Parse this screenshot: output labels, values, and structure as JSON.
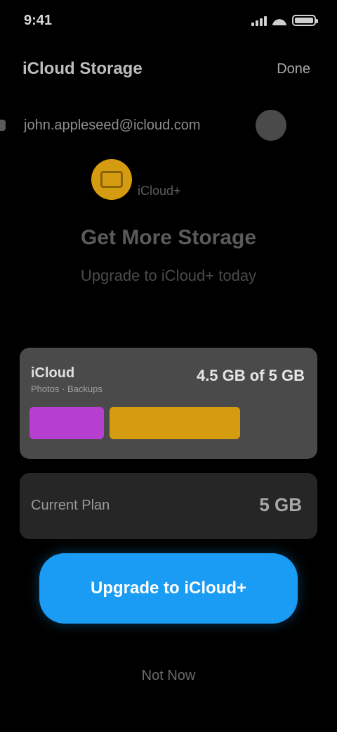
{
  "status_bar": {
    "time": "9:41"
  },
  "header": {
    "title": "iCloud Storage",
    "right_button": "Done"
  },
  "account": {
    "email": "john.appleseed@icloud.com"
  },
  "hero": {
    "icon": "cloud-icon",
    "label": "iCloud+",
    "title": "Get More Storage",
    "subtitle": "Upgrade to iCloud+ today"
  },
  "storage": {
    "label": "iCloud",
    "value": "4.5 GB of 5 GB",
    "subtitle": "Photos · Backups",
    "segments": [
      {
        "name": "Photos",
        "fraction": 0.28,
        "color": "#b63fd0"
      },
      {
        "name": "Backups",
        "fraction": 0.49,
        "color": "#d59b11"
      },
      {
        "name": "Free",
        "fraction": 0.23,
        "color": "#4a4a4a"
      }
    ]
  },
  "plan": {
    "label": "Current Plan",
    "value": "5 GB"
  },
  "primary_button": {
    "label": "Upgrade to iCloud+"
  },
  "secondary_link": {
    "label": "Not Now"
  },
  "colors": {
    "accent": "#1a9cf4",
    "gold": "#d59b11",
    "purple": "#b63fd0"
  }
}
